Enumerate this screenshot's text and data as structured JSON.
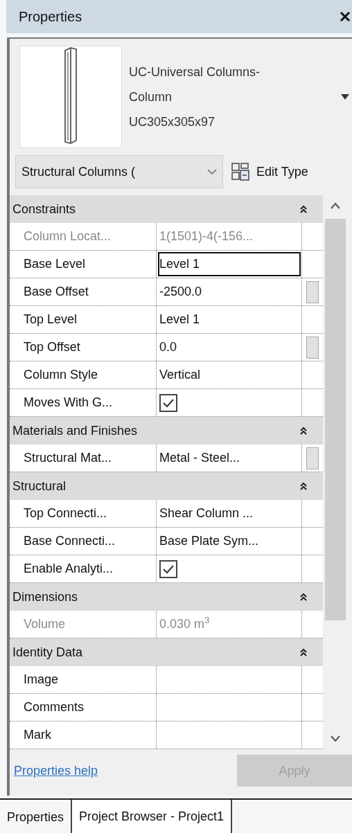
{
  "panel": {
    "title": "Properties"
  },
  "type_selector": {
    "name_lines": [
      "UC-Universal Columns-",
      "Column",
      "UC305x305x97"
    ]
  },
  "category_filter": {
    "value": "Structural Columns ("
  },
  "edit_type": {
    "label": "Edit Type"
  },
  "groups": [
    {
      "title": "Constraints",
      "expanded": true,
      "rows": [
        {
          "kind": "text",
          "name": "Column Locat...",
          "value": "1(1501)-4(-156...",
          "disabled": true,
          "focused": false,
          "button": false
        },
        {
          "kind": "text",
          "name": "Base Level",
          "value": "Level 1",
          "disabled": false,
          "focused": true,
          "button": false
        },
        {
          "kind": "text",
          "name": "Base Offset",
          "value": "-2500.0",
          "disabled": false,
          "focused": false,
          "button": true
        },
        {
          "kind": "text",
          "name": "Top Level",
          "value": "Level 1",
          "disabled": false,
          "focused": false,
          "button": false
        },
        {
          "kind": "text",
          "name": "Top Offset",
          "value": "0.0",
          "disabled": false,
          "focused": false,
          "button": true
        },
        {
          "kind": "text",
          "name": "Column Style",
          "value": "Vertical",
          "disabled": false,
          "focused": false,
          "button": false
        },
        {
          "kind": "checkbox",
          "name": "Moves With G...",
          "checked": true,
          "disabled": false,
          "focused": false,
          "button": false
        }
      ]
    },
    {
      "title": "Materials and Finishes",
      "expanded": true,
      "rows": [
        {
          "kind": "text",
          "name": "Structural Mat...",
          "value": "Metal - Steel...",
          "disabled": false,
          "focused": false,
          "button": true
        }
      ]
    },
    {
      "title": "Structural",
      "expanded": true,
      "rows": [
        {
          "kind": "text",
          "name": "Top Connecti...",
          "value": "Shear Column ...",
          "disabled": false,
          "focused": false,
          "button": false
        },
        {
          "kind": "text",
          "name": "Base Connecti...",
          "value": "Base Plate Sym...",
          "disabled": false,
          "focused": false,
          "button": false
        },
        {
          "kind": "checkbox",
          "name": "Enable Analyti...",
          "checked": true,
          "disabled": false,
          "focused": false,
          "button": false
        }
      ]
    },
    {
      "title": "Dimensions",
      "expanded": true,
      "rows": [
        {
          "kind": "text",
          "name": "Volume",
          "value": "0.030 m$^{3}$",
          "disabled": true,
          "focused": false,
          "button": false
        }
      ]
    },
    {
      "title": "Identity Data",
      "expanded": true,
      "rows": [
        {
          "kind": "text",
          "name": "Image",
          "disabled": false,
          "focused": false,
          "button": false
        },
        {
          "kind": "text",
          "name": "Comments",
          "disabled": false,
          "focused": false,
          "button": false
        },
        {
          "kind": "text",
          "name": "Mark",
          "disabled": false,
          "focused": false,
          "button": false
        }
      ]
    }
  ],
  "footer": {
    "help_link": "Properties help",
    "apply": {
      "label": "Apply",
      "disabled": true
    }
  },
  "tabs": [
    {
      "label": "Properties",
      "selected": true
    },
    {
      "label": "Project Browser - Project1",
      "selected": false
    }
  ]
}
